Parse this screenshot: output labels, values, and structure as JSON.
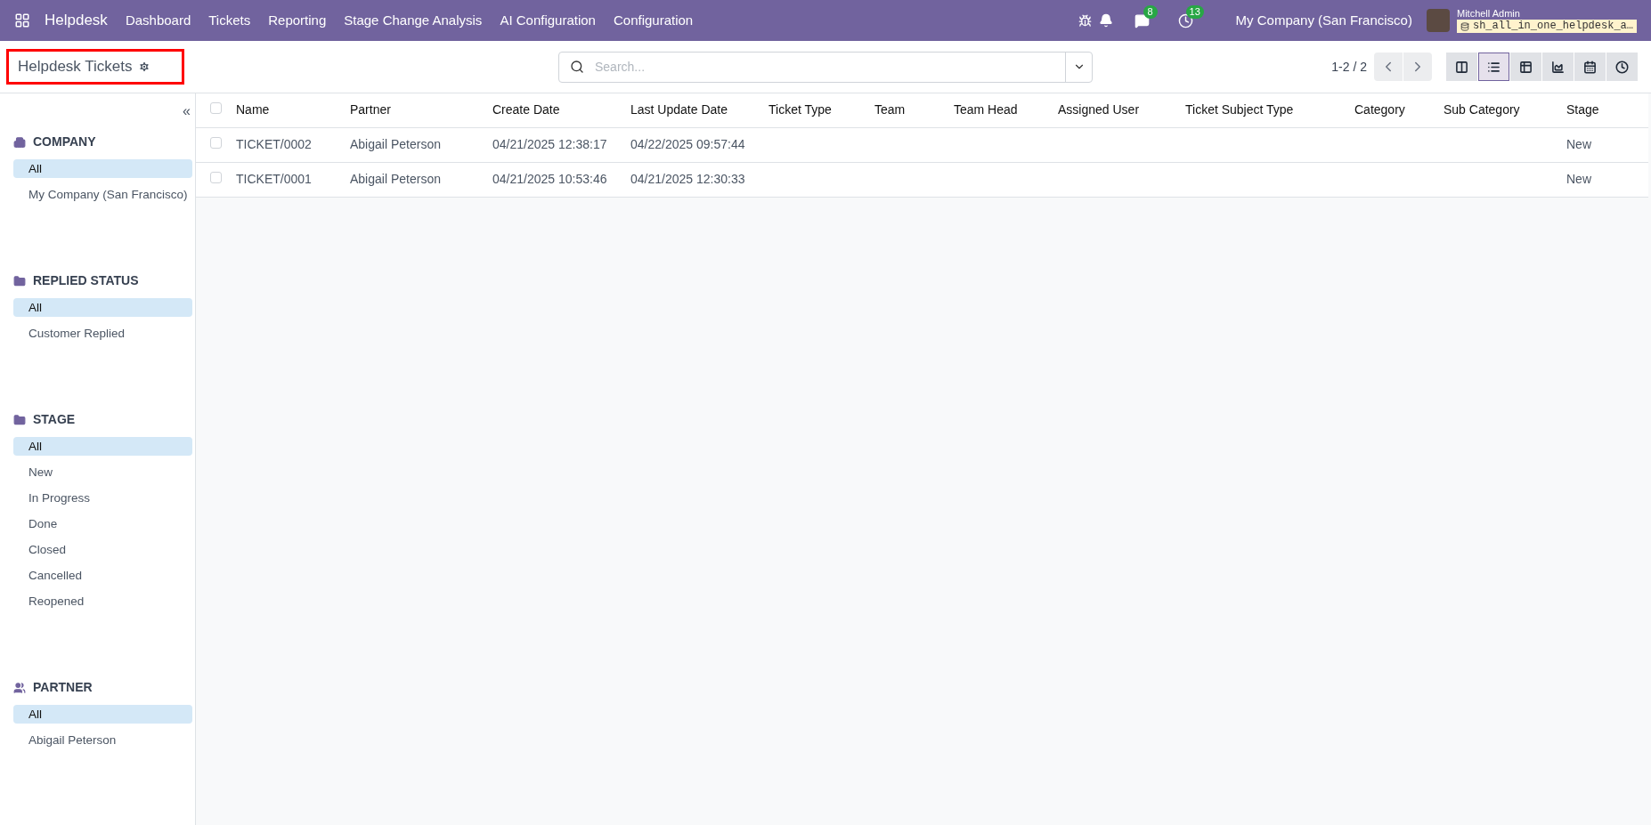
{
  "navbar": {
    "app_name": "Helpdesk",
    "menu": [
      "Dashboard",
      "Tickets",
      "Reporting",
      "Stage Change Analysis",
      "AI Configuration",
      "Configuration"
    ],
    "messages_badge": "8",
    "activities_badge": "13",
    "company": "My Company (San Francisco)",
    "user": "Mitchell Admin",
    "database": "sh_all_in_one_helpdesk_a…"
  },
  "control_panel": {
    "title": "Helpdesk Tickets",
    "search": {
      "placeholder": "Search..."
    },
    "pager": "1-2 / 2",
    "views": [
      {
        "kind": "kanban",
        "selected": false
      },
      {
        "kind": "list",
        "selected": true
      },
      {
        "kind": "pivot",
        "selected": false
      },
      {
        "kind": "graph",
        "selected": false
      },
      {
        "kind": "calendar",
        "selected": false
      },
      {
        "kind": "activity",
        "selected": false
      }
    ]
  },
  "sidebar": {
    "collapse": "«",
    "sections": [
      {
        "kind": "company",
        "title": "COMPANY",
        "items": [
          {
            "label": "All",
            "selected": true
          },
          {
            "label": "My Company (San Francisco)",
            "selected": false
          }
        ]
      },
      {
        "kind": "status",
        "title": "REPLIED STATUS",
        "items": [
          {
            "label": "All",
            "selected": true
          },
          {
            "label": "Customer Replied",
            "selected": false
          }
        ]
      },
      {
        "kind": "stage",
        "title": "STAGE",
        "items": [
          {
            "label": "All",
            "selected": true
          },
          {
            "label": "New",
            "selected": false
          },
          {
            "label": "In Progress",
            "selected": false
          },
          {
            "label": "Done",
            "selected": false
          },
          {
            "label": "Closed",
            "selected": false
          },
          {
            "label": "Cancelled",
            "selected": false
          },
          {
            "label": "Reopened",
            "selected": false
          }
        ]
      },
      {
        "kind": "partner",
        "title": "PARTNER",
        "items": [
          {
            "label": "All",
            "selected": true
          },
          {
            "label": "Abigail Peterson",
            "selected": false
          }
        ]
      }
    ]
  },
  "table": {
    "select_all": {
      "checked": false
    },
    "columns": [
      "Name",
      "Partner",
      "Create Date",
      "Last Update Date",
      "Ticket Type",
      "Team",
      "Team Head",
      "Assigned User",
      "Ticket Subject Type",
      "Category",
      "Sub Category",
      "Stage"
    ],
    "rows": [
      {
        "checked": false,
        "cells": [
          "TICKET/0002",
          "Abigail Peterson",
          "04/21/2025 12:38:17",
          "04/22/2025 09:57:44",
          "",
          "",
          "",
          "",
          "",
          "",
          "",
          "New"
        ]
      },
      {
        "checked": false,
        "cells": [
          "TICKET/0001",
          "Abigail Peterson",
          "04/21/2025 10:53:46",
          "04/21/2025 12:30:33",
          "",
          "",
          "",
          "",
          "",
          "",
          "",
          "New"
        ]
      }
    ]
  }
}
